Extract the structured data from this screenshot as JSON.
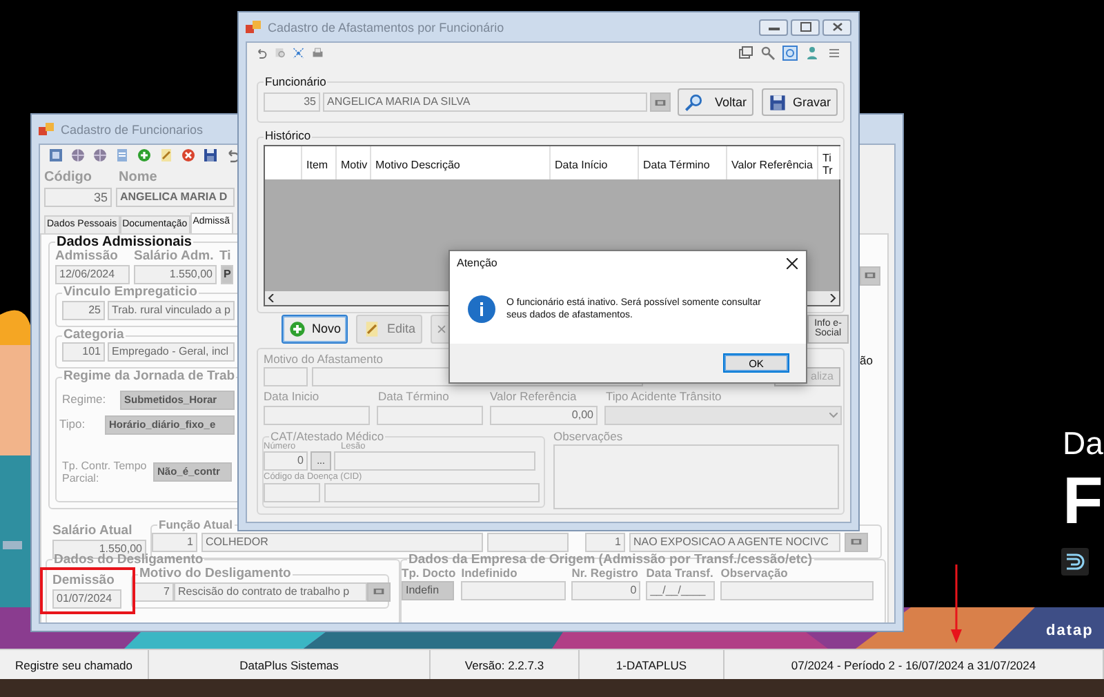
{
  "desktop": {
    "banner_lines": [
      "Da",
      "F"
    ],
    "brand": "datap"
  },
  "employee_window": {
    "title": "Cadastro de Funcionarios",
    "code_label": "Código",
    "name_label": "Nome",
    "code": "35",
    "name": "ANGELICA MARIA D",
    "tabs": [
      {
        "label": "Dados Pessoais",
        "selected": false
      },
      {
        "label": "Documentação",
        "selected": false
      },
      {
        "label": "Admissã",
        "selected": true
      }
    ],
    "admission": {
      "title": "Dados Admissionais",
      "labels": [
        "Admissão",
        "Salário Adm.",
        "Ti"
      ],
      "date": "12/06/2024",
      "salary": "1.550,00",
      "type": "P"
    },
    "employment_link": {
      "title": "Vinculo Empregaticio",
      "code": "25",
      "description": "Trab. rural vinculado a p"
    },
    "category": {
      "title": "Categoria",
      "code": "101",
      "description": "Empregado - Geral, incl"
    },
    "regime": {
      "title": "Regime da Jornada de Trab",
      "rows": [
        {
          "label": "Regime:",
          "value": "Submetidos_Horar"
        },
        {
          "label": "Tipo:",
          "value": "Horário_diário_fixo_e"
        },
        {
          "label": "Tp. Contr. Tempo Parcial:",
          "value": "Não_é_contr"
        }
      ]
    },
    "side_fragment": "ão",
    "current_salary": {
      "label": "Salário Atual",
      "value": "1.550,00"
    },
    "current_role": {
      "label": "Função Atual",
      "code": "1",
      "name": "COLHEDOR"
    },
    "exposure": {
      "code": "1",
      "name": "NAO EXPOSICAO A AGENTE NOCIVC"
    },
    "dismissal": {
      "title": "Dados do Desligamento",
      "date_label": "Demissão",
      "date": "01/07/2024",
      "reason_label": "Motivo do Desligamento",
      "reason_code": "7",
      "reason": "Rescisão do contrato de trabalho p"
    },
    "origin": {
      "title": "Dados da Empresa de Origem (Admissão por Transf./cessão/etc)",
      "fields": [
        {
          "label": "Tp. Docto",
          "kind": "select",
          "value": "Indefin"
        },
        {
          "label": "Indefinido",
          "kind": "text"
        },
        {
          "label": "Nr. Registro",
          "kind": "number",
          "value": "0"
        },
        {
          "label": "Data Transf.",
          "kind": "text",
          "value": "__/__/____"
        },
        {
          "label": "Observação",
          "kind": "spin"
        }
      ]
    }
  },
  "leave_window": {
    "title": "Cadastro de Afastamentos por Funcionário",
    "employee_group": "Funcionário",
    "employee_code": "35",
    "employee_name": "ANGELICA MARIA DA SILVA",
    "buttons": [
      {
        "label": "Voltar",
        "kind": "search"
      },
      {
        "label": "Gravar",
        "kind": "save"
      }
    ],
    "history": {
      "title": "Histórico",
      "columns": [
        "Item",
        "Motiv",
        "Motivo Descrição",
        "Data Início",
        "Data Término",
        "Valor Referência",
        "Ti Tr"
      ]
    },
    "actions": [
      {
        "label": "Novo",
        "kind": "add",
        "focused": true,
        "disabled": false
      },
      {
        "label": "Edita",
        "kind": "edit",
        "focused": false,
        "disabled": true
      },
      {
        "kind": "delete",
        "focused": false,
        "disabled": true
      }
    ],
    "info_button": "Info e-Social",
    "form": {
      "reason_label": "Motivo do Afastamento",
      "update_button": "aliza",
      "labels": [
        "Data Inicio",
        "Data Término",
        "Valor Referência",
        "Tipo Acidente Trânsito"
      ],
      "reference_value": "0,00",
      "cat_title": "CAT/Atestado Médico",
      "number_label": "Número",
      "number": "0",
      "lookup_button": "...",
      "injury_label": "Lesão",
      "cid_label": "Código da Doença (CID)",
      "notes_label": "Observações"
    }
  },
  "dialog": {
    "title": "Atenção",
    "message": "O funcionário está inativo. Será possível somente consultar seus dados de afastamentos.",
    "button": "OK"
  },
  "status_bar": [
    "Registre seu chamado",
    "DataPlus Sistemas",
    "Versão: 2.2.7.3",
    "1-DATAPLUS",
    "07/2024 - Período 2 - 16/07/2024 a 31/07/2024"
  ]
}
